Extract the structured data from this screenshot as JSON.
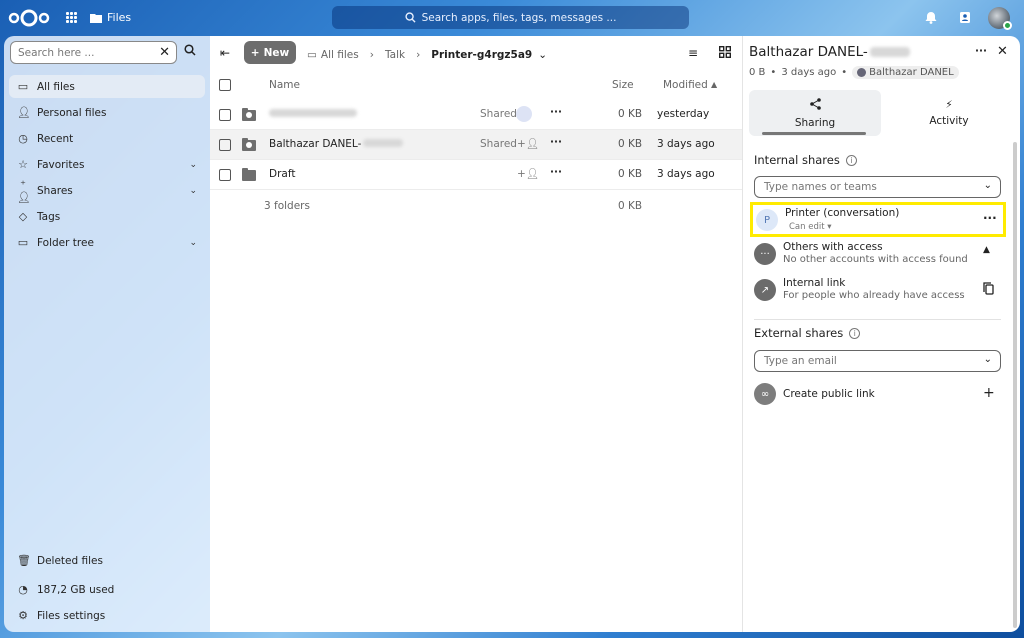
{
  "topbar": {
    "app_name": "Files",
    "search_placeholder": "Search apps, files, tags, messages ..."
  },
  "nav": {
    "search_placeholder": "Search here ...",
    "items": [
      {
        "label": "All files",
        "icon": "folder-icon"
      },
      {
        "label": "Personal files",
        "icon": "person-icon"
      },
      {
        "label": "Recent",
        "icon": "clock-icon"
      },
      {
        "label": "Favorites",
        "icon": "star-icon"
      },
      {
        "label": "Shares",
        "icon": "share-icon"
      },
      {
        "label": "Tags",
        "icon": "tag-icon"
      },
      {
        "label": "Folder tree",
        "icon": "folder-tree-icon"
      }
    ],
    "bottom": [
      {
        "label": "Deleted files",
        "icon": "trash-icon"
      },
      {
        "label": "187,2 GB used",
        "icon": "pie-icon"
      },
      {
        "label": "Files settings",
        "icon": "gear-icon"
      }
    ]
  },
  "toolbar": {
    "new_label": "New",
    "breadcrumbs": [
      "All files",
      "Talk",
      "Printer-g4rgz5a9"
    ]
  },
  "table": {
    "headers": {
      "name": "Name",
      "size": "Size",
      "modified": "Modified"
    },
    "rows": [
      {
        "name": "",
        "shared": "Shared",
        "size": "0 KB",
        "modified": "yesterday"
      },
      {
        "name": "Balthazar DANEL-",
        "shared": "Shared",
        "size": "0 KB",
        "modified": "3 days ago"
      },
      {
        "name": "Draft",
        "shared": "",
        "size": "0 KB",
        "modified": "3 days ago"
      }
    ],
    "footer": {
      "count": "3 folders",
      "size": "0 KB"
    }
  },
  "sidebar": {
    "title": "Balthazar DANEL-",
    "meta_size": "0 B",
    "meta_time": "3 days ago",
    "owner": "Balthazar DANEL",
    "tabs": [
      {
        "label": "Sharing"
      },
      {
        "label": "Activity"
      }
    ],
    "internal": {
      "heading": "Internal shares",
      "placeholder": "Type names or teams",
      "share": {
        "avatar": "P",
        "name": "Printer (conversation)",
        "permission": "Can edit"
      },
      "others": {
        "title": "Others with access",
        "subtitle": "No other accounts with access found"
      },
      "link": {
        "title": "Internal link",
        "subtitle": "For people who already have access"
      }
    },
    "external": {
      "heading": "External shares",
      "placeholder": "Type an email",
      "public_link": "Create public link"
    }
  },
  "colors": {
    "highlight": "#ffeb00",
    "accent": "#1a5fb4",
    "new_button": "#6d6d6d"
  }
}
